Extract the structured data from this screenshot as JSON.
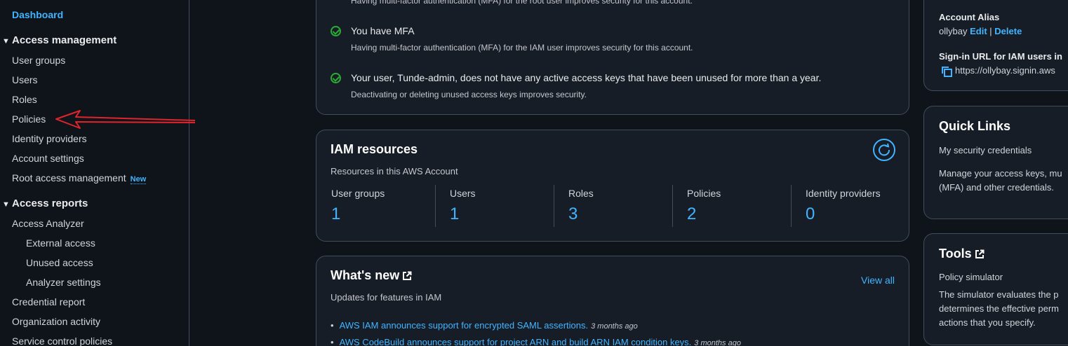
{
  "sidebar": {
    "dashboard": "Dashboard",
    "access_management": {
      "title": "Access management",
      "items": [
        "User groups",
        "Users",
        "Roles",
        "Policies",
        "Identity providers",
        "Account settings",
        "Root access management"
      ],
      "new_badge": "New"
    },
    "access_reports": {
      "title": "Access reports",
      "analyzer": "Access Analyzer",
      "sub_items": [
        "External access",
        "Unused access",
        "Analyzer settings"
      ],
      "items": [
        "Credential report",
        "Organization activity",
        "Service control policies"
      ]
    }
  },
  "security": {
    "root_mfa_desc": "Having multi-factor authentication (MFA) for the root user improves security for this account.",
    "mfa_title": "You have MFA",
    "mfa_desc": "Having multi-factor authentication (MFA) for the IAM user improves security for this account.",
    "keys_title": "Your user, Tunde-admin, does not have any active access keys that have been unused for more than a year.",
    "keys_desc": "Deactivating or deleting unused access keys improves security."
  },
  "iam_resources": {
    "title": "IAM resources",
    "subtitle": "Resources in this AWS Account",
    "columns": [
      {
        "label": "User groups",
        "value": "1"
      },
      {
        "label": "Users",
        "value": "1"
      },
      {
        "label": "Roles",
        "value": "3"
      },
      {
        "label": "Policies",
        "value": "2"
      },
      {
        "label": "Identity providers",
        "value": "0"
      }
    ]
  },
  "whats_new": {
    "title": "What's new",
    "subtitle": "Updates for features in IAM",
    "view_all": "View all",
    "items": [
      {
        "text": "AWS IAM announces support for encrypted SAML assertions.",
        "ago": "3 months ago"
      },
      {
        "text": "AWS CodeBuild announces support for project ARN and build ARN IAM condition keys.",
        "ago": "3 months ago"
      }
    ]
  },
  "account": {
    "alias_label": "Account Alias",
    "alias_value": "ollybay",
    "edit": "Edit",
    "separator": "|",
    "delete": "Delete",
    "signin_label": "Sign-in URL for IAM users in",
    "signin_url": "https://ollybay.signin.aws"
  },
  "quick_links": {
    "title": "Quick Links",
    "link": "My security credentials",
    "desc_line1": "Manage your access keys, mu",
    "desc_line2": "(MFA) and other credentials."
  },
  "tools": {
    "title": "Tools",
    "link": "Policy simulator",
    "desc_line1": "The simulator evaluates the p",
    "desc_line2": "determines the effective perm",
    "desc_line3": "actions that you specify."
  },
  "annotation": {
    "color": "#e0242b"
  }
}
